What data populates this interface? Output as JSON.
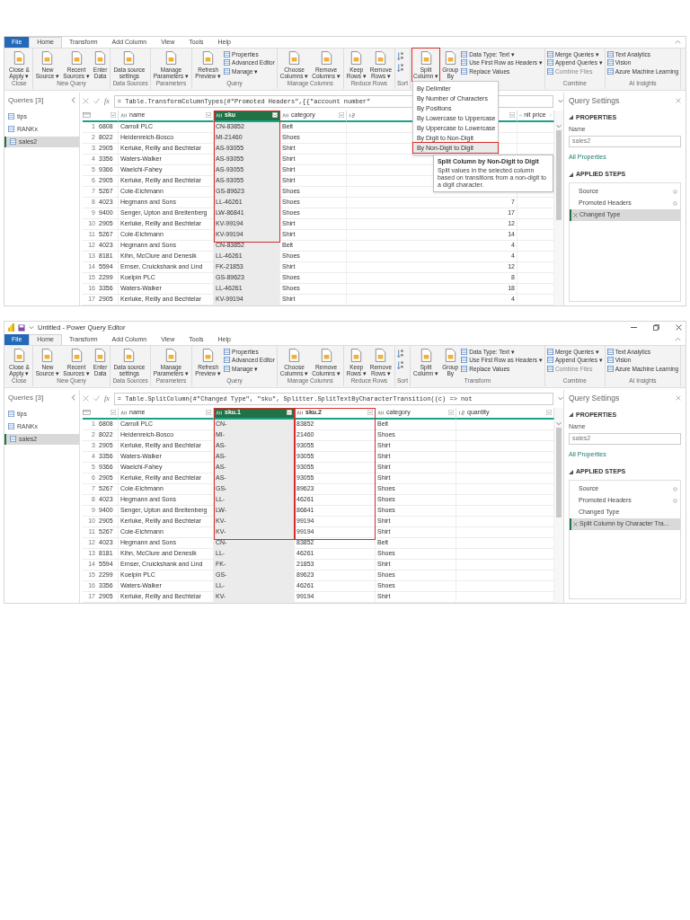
{
  "screens": [
    {
      "tabs": [
        {
          "label": "File",
          "kind": "file",
          "selected": false
        },
        {
          "label": "Home",
          "kind": "tab",
          "selected": true
        },
        {
          "label": "Transform",
          "kind": "tab",
          "selected": false
        },
        {
          "label": "Add Column",
          "kind": "tab",
          "selected": false
        },
        {
          "label": "View",
          "kind": "tab",
          "selected": false
        },
        {
          "label": "Tools",
          "kind": "tab",
          "selected": false
        },
        {
          "label": "Help",
          "kind": "tab",
          "selected": false
        }
      ],
      "ribbon": [
        {
          "label": "Close",
          "buttons": [
            {
              "label": "Close &\nApply ▾",
              "kind": "large",
              "highlighted": false,
              "disabled": false
            }
          ]
        },
        {
          "label": "New Query",
          "buttons": [
            {
              "label": "New\nSource ▾",
              "kind": "large",
              "highlighted": false,
              "disabled": false
            },
            {
              "label": "Recent\nSources ▾",
              "kind": "large",
              "highlighted": false,
              "disabled": false
            },
            {
              "label": "Enter\nData",
              "kind": "large",
              "highlighted": false,
              "disabled": false
            }
          ]
        },
        {
          "label": "Data Sources",
          "buttons": [
            {
              "label": "Data source\nsettings",
              "kind": "large",
              "highlighted": false,
              "disabled": false
            }
          ]
        },
        {
          "label": "Parameters",
          "buttons": [
            {
              "label": "Manage\nParameters ▾",
              "kind": "large",
              "highlighted": false,
              "disabled": false
            }
          ]
        },
        {
          "label": "Query",
          "buttons": [
            {
              "label": "Refresh\nPreview ▾",
              "kind": "large",
              "highlighted": false,
              "disabled": false
            },
            {
              "label": "Properties",
              "kind": "small",
              "highlighted": false,
              "disabled": false
            },
            {
              "label": "Advanced Editor",
              "kind": "small",
              "highlighted": false,
              "disabled": false
            },
            {
              "label": "Manage ▾",
              "kind": "small",
              "highlighted": false,
              "disabled": false
            }
          ]
        },
        {
          "label": "Manage Columns",
          "buttons": [
            {
              "label": "Choose\nColumns ▾",
              "kind": "large",
              "highlighted": false,
              "disabled": false
            },
            {
              "label": "Remove\nColumns ▾",
              "kind": "large",
              "highlighted": false,
              "disabled": false
            }
          ]
        },
        {
          "label": "Reduce Rows",
          "buttons": [
            {
              "label": "Keep\nRows ▾",
              "kind": "large",
              "highlighted": false,
              "disabled": false
            },
            {
              "label": "Remove\nRows ▾",
              "kind": "large",
              "highlighted": false,
              "disabled": false
            }
          ]
        },
        {
          "label": "Sort",
          "buttons": [
            {
              "kind": "icon",
              "highlighted": false,
              "disabled": false
            },
            {
              "kind": "icon",
              "highlighted": false,
              "disabled": false
            }
          ]
        },
        {
          "buttons": [
            {
              "label": "Split\nColumn ▾",
              "kind": "large",
              "highlighted": true,
              "disabled": false
            },
            {
              "label": "Group\nBy",
              "kind": "large",
              "highlighted": false,
              "disabled": false
            },
            {
              "label": "Data Type: Text ▾",
              "kind": "small",
              "highlighted": false,
              "disabled": false
            },
            {
              "label": "Use First Row as Headers ▾",
              "kind": "small",
              "highlighted": false,
              "disabled": false
            },
            {
              "label": "Replace Values",
              "kind": "small",
              "highlighted": false,
              "disabled": false
            }
          ]
        },
        {
          "label": "Combine",
          "buttons": [
            {
              "label": "Merge Queries ▾",
              "kind": "small",
              "highlighted": false,
              "disabled": false
            },
            {
              "label": "Append Queries ▾",
              "kind": "small",
              "highlighted": false,
              "disabled": false
            },
            {
              "label": "Combine Files",
              "kind": "small",
              "highlighted": false,
              "disabled": true
            }
          ]
        },
        {
          "label": "AI Insights",
          "buttons": [
            {
              "label": "Text Analytics",
              "kind": "small",
              "highlighted": false,
              "disabled": false
            },
            {
              "label": "Vision",
              "kind": "small",
              "highlighted": false,
              "disabled": false
            },
            {
              "label": "Azure Machine Learning",
              "kind": "small",
              "highlighted": false,
              "disabled": false
            }
          ]
        }
      ],
      "queries": {
        "title": "Queries [3]",
        "items": [
          {
            "label": "tips",
            "selected": false
          },
          {
            "label": "RANKx",
            "selected": false
          },
          {
            "label": "sales2",
            "selected": true
          }
        ]
      },
      "formula": {
        "fx": "fx",
        "text": "= Table.TransformColumnTypes(#\"Promoted Headers\",{{\"account number\""
      },
      "table": {
        "columns": [
          {
            "kind": "id",
            "selected": false,
            "highlighted": false
          },
          {
            "label": "name",
            "kind": "text",
            "selected": false,
            "highlighted": false
          },
          {
            "label": "sku",
            "kind": "text",
            "selected": true,
            "highlighted": true
          },
          {
            "label": "category",
            "kind": "text",
            "selected": false,
            "highlighted": false
          },
          {
            "kind": "number",
            "selected": false,
            "highlighted": false
          },
          {
            "label": "nit price",
            "kind": "text",
            "selected": false,
            "highlighted": false
          }
        ],
        "rows": [
          {
            "num": "1",
            "cells": [
              "6808",
              "Carroll PLC",
              "CN-83852",
              "Belt",
              null,
              null
            ]
          },
          {
            "num": "2",
            "cells": [
              "8022",
              "Heidenreich-Bosco",
              "MI-21460",
              "Shoes",
              null,
              null
            ]
          },
          {
            "num": "3",
            "cells": [
              "2905",
              "Kerluke, Reilly and Bechtelar",
              "AS-93055",
              "Shirt",
              null,
              null
            ]
          },
          {
            "num": "4",
            "cells": [
              "3356",
              "Waters-Walker",
              "AS-93055",
              "Shirt",
              null,
              null
            ]
          },
          {
            "num": "5",
            "cells": [
              "9366",
              "Waelchi-Fahey",
              "AS-93055",
              "Shirt",
              null,
              null
            ]
          },
          {
            "num": "6",
            "cells": [
              "2905",
              "Kerluke, Reilly and Bechtelar",
              "AS-93055",
              "Shirt",
              null,
              null
            ]
          },
          {
            "num": "7",
            "cells": [
              "5267",
              "Cole-Eichmann",
              "GS-89623",
              "Shoes",
              null,
              null
            ]
          },
          {
            "num": "8",
            "cells": [
              "4023",
              "Hegmann and Sons",
              "LL-46261",
              "Shoes",
              "7",
              null
            ]
          },
          {
            "num": "9",
            "cells": [
              "9400",
              "Senger, Upton and Breitenberg",
              "LW-86841",
              "Shoes",
              "17",
              null
            ]
          },
          {
            "num": "10",
            "cells": [
              "2905",
              "Kerluke, Reilly and Bechtelar",
              "KV-99194",
              "Shirt",
              "12",
              null
            ]
          },
          {
            "num": "11",
            "cells": [
              "5267",
              "Cole-Eichmann",
              "KV-99194",
              "Shirt",
              "14",
              null
            ]
          },
          {
            "num": "12",
            "cells": [
              "4023",
              "Hegmann and Sons",
              "CN-83852",
              "Belt",
              "4",
              null
            ]
          },
          {
            "num": "13",
            "cells": [
              "8181",
              "Kihn, McClure and Denesik",
              "LL-46261",
              "Shoes",
              "4",
              null
            ]
          },
          {
            "num": "14",
            "cells": [
              "5594",
              "Ernser, Cruickshank and Lind",
              "FK-21853",
              "Shirt",
              "12",
              null
            ]
          },
          {
            "num": "15",
            "cells": [
              "2299",
              "Koelpin PLC",
              "GS-89623",
              "Shoes",
              "8",
              null
            ]
          },
          {
            "num": "16",
            "cells": [
              "3356",
              "Waters-Walker",
              "LL-46261",
              "Shoes",
              "18",
              null
            ]
          },
          {
            "num": "17",
            "cells": [
              "2905",
              "Kerluke, Reilly and Bechtelar",
              "KV-99194",
              "Shirt",
              "4",
              null
            ]
          }
        ]
      },
      "settings": {
        "title": "Query Settings",
        "properties_label": "PROPERTIES",
        "name_label": "Name",
        "name_value": "sales2",
        "all_properties": "All Properties",
        "steps_label": "APPLIED STEPS",
        "steps": [
          {
            "label": "Source",
            "settings": true,
            "selected": false
          },
          {
            "label": "Promoted Headers",
            "settings": true,
            "selected": false
          },
          {
            "label": "Changed Type",
            "settings": false,
            "selected": true
          }
        ]
      },
      "split_menu": {
        "items": [
          {
            "label": "By Delimiter",
            "highlighted": false
          },
          {
            "label": "By Number of Characters",
            "highlighted": false
          },
          {
            "label": "By Positions",
            "highlighted": false
          },
          {
            "label": "By Lowercase to Uppercase",
            "highlighted": false
          },
          {
            "label": "By Uppercase to Lowercase",
            "highlighted": false
          },
          {
            "label": "By Digit to Non-Digit",
            "highlighted": false
          },
          {
            "label": "By Non-Digit to Digit",
            "highlighted": true
          }
        ],
        "tooltip": {
          "title": "Split Column by Non-Digit to Digit",
          "text": "Split values in the selected column based on transitions from a non-digit to a digit character."
        }
      }
    },
    {
      "title_bar": {
        "title": "Untitled - Power Query Editor"
      },
      "tabs": [
        {
          "label": "File",
          "kind": "file",
          "selected": false
        },
        {
          "label": "Home",
          "kind": "tab",
          "selected": true
        },
        {
          "label": "Transform",
          "kind": "tab",
          "selected": false
        },
        {
          "label": "Add Column",
          "kind": "tab",
          "selected": false
        },
        {
          "label": "View",
          "kind": "tab",
          "selected": false
        },
        {
          "label": "Tools",
          "kind": "tab",
          "selected": false
        },
        {
          "label": "Help",
          "kind": "tab",
          "selected": false
        }
      ],
      "ribbon": [
        {
          "label": "Close",
          "buttons": [
            {
              "label": "Close &\nApply ▾",
              "kind": "large",
              "highlighted": false,
              "disabled": false
            }
          ]
        },
        {
          "label": "New Query",
          "buttons": [
            {
              "label": "New\nSource ▾",
              "kind": "large",
              "highlighted": false,
              "disabled": false
            },
            {
              "label": "Recent\nSources ▾",
              "kind": "large",
              "highlighted": false,
              "disabled": false
            },
            {
              "label": "Enter\nData",
              "kind": "large",
              "highlighted": false,
              "disabled": false
            }
          ]
        },
        {
          "label": "Data Sources",
          "buttons": [
            {
              "label": "Data source\nsettings",
              "kind": "large",
              "highlighted": false,
              "disabled": false
            }
          ]
        },
        {
          "label": "Parameters",
          "buttons": [
            {
              "label": "Manage\nParameters ▾",
              "kind": "large",
              "highlighted": false,
              "disabled": false
            }
          ]
        },
        {
          "label": "Query",
          "buttons": [
            {
              "label": "Refresh\nPreview ▾",
              "kind": "large",
              "highlighted": false,
              "disabled": false
            },
            {
              "label": "Properties",
              "kind": "small",
              "highlighted": false,
              "disabled": false
            },
            {
              "label": "Advanced Editor",
              "kind": "small",
              "highlighted": false,
              "disabled": false
            },
            {
              "label": "Manage ▾",
              "kind": "small",
              "highlighted": false,
              "disabled": false
            }
          ]
        },
        {
          "label": "Manage Columns",
          "buttons": [
            {
              "label": "Choose\nColumns ▾",
              "kind": "large",
              "highlighted": false,
              "disabled": false
            },
            {
              "label": "Remove\nColumns ▾",
              "kind": "large",
              "highlighted": false,
              "disabled": false
            }
          ]
        },
        {
          "label": "Reduce Rows",
          "buttons": [
            {
              "label": "Keep\nRows ▾",
              "kind": "large",
              "highlighted": false,
              "disabled": false
            },
            {
              "label": "Remove\nRows ▾",
              "kind": "large",
              "highlighted": false,
              "disabled": false
            }
          ]
        },
        {
          "label": "Sort",
          "buttons": [
            {
              "kind": "icon",
              "highlighted": false,
              "disabled": false
            },
            {
              "kind": "icon",
              "highlighted": false,
              "disabled": false
            }
          ]
        },
        {
          "label": "Transform",
          "buttons": [
            {
              "label": "Split\nColumn ▾",
              "kind": "large",
              "highlighted": false,
              "disabled": false
            },
            {
              "label": "Group\nBy",
              "kind": "large",
              "highlighted": false,
              "disabled": false
            },
            {
              "label": "Data Type: Text ▾",
              "kind": "small",
              "highlighted": false,
              "disabled": false
            },
            {
              "label": "Use First Row as Headers ▾",
              "kind": "small",
              "highlighted": false,
              "disabled": false
            },
            {
              "label": "Replace Values",
              "kind": "small",
              "highlighted": false,
              "disabled": false
            }
          ]
        },
        {
          "label": "Combine",
          "buttons": [
            {
              "label": "Merge Queries ▾",
              "kind": "small",
              "highlighted": false,
              "disabled": false
            },
            {
              "label": "Append Queries ▾",
              "kind": "small",
              "highlighted": false,
              "disabled": false
            },
            {
              "label": "Combine Files",
              "kind": "small",
              "highlighted": false,
              "disabled": true
            }
          ]
        },
        {
          "label": "AI Insights",
          "buttons": [
            {
              "label": "Text Analytics",
              "kind": "small",
              "highlighted": false,
              "disabled": false
            },
            {
              "label": "Vision",
              "kind": "small",
              "highlighted": false,
              "disabled": false
            },
            {
              "label": "Azure Machine Learning",
              "kind": "small",
              "highlighted": false,
              "disabled": false
            }
          ]
        }
      ],
      "queries": {
        "title": "Queries [3]",
        "items": [
          {
            "label": "tips",
            "selected": false
          },
          {
            "label": "RANKx",
            "selected": false
          },
          {
            "label": "sales2",
            "selected": true
          }
        ]
      },
      "formula": {
        "fx": "fx",
        "text": "= Table.SplitColumn(#\"Changed Type\", \"sku\", Splitter.SplitTextByCharacterTransition((c) => not"
      },
      "table": {
        "columns": [
          {
            "kind": "id",
            "selected": false,
            "highlighted": false
          },
          {
            "label": "name",
            "kind": "text",
            "selected": false,
            "highlighted": false
          },
          {
            "label": "sku.1",
            "kind": "text",
            "selected": true,
            "highlighted": true
          },
          {
            "label": "sku.2",
            "kind": "text",
            "selected": false,
            "highlighted": true
          },
          {
            "label": "category",
            "kind": "text",
            "selected": false,
            "highlighted": false
          },
          {
            "label": "quantity",
            "kind": "number",
            "selected": false,
            "highlighted": false
          }
        ],
        "rows": [
          {
            "num": "1",
            "cells": [
              "6808",
              "Carroll PLC",
              "CN-",
              "83852",
              "Belt"
            ]
          },
          {
            "num": "2",
            "cells": [
              "8022",
              "Heidenreich-Bosco",
              "MI-",
              "21460",
              "Shoes"
            ]
          },
          {
            "num": "3",
            "cells": [
              "2905",
              "Kerluke, Reilly and Bechtelar",
              "AS-",
              "93055",
              "Shirt"
            ]
          },
          {
            "num": "4",
            "cells": [
              "3356",
              "Waters-Walker",
              "AS-",
              "93055",
              "Shirt"
            ]
          },
          {
            "num": "5",
            "cells": [
              "9366",
              "Waelchi-Fahey",
              "AS-",
              "93055",
              "Shirt"
            ]
          },
          {
            "num": "6",
            "cells": [
              "2905",
              "Kerluke, Reilly and Bechtelar",
              "AS-",
              "93055",
              "Shirt"
            ]
          },
          {
            "num": "7",
            "cells": [
              "5267",
              "Cole-Eichmann",
              "GS-",
              "89623",
              "Shoes"
            ]
          },
          {
            "num": "8",
            "cells": [
              "4023",
              "Hegmann and Sons",
              "LL-",
              "46261",
              "Shoes"
            ]
          },
          {
            "num": "9",
            "cells": [
              "9400",
              "Senger, Upton and Breitenberg",
              "LW-",
              "86841",
              "Shoes"
            ]
          },
          {
            "num": "10",
            "cells": [
              "2905",
              "Kerluke, Reilly and Bechtelar",
              "KV-",
              "99194",
              "Shirt"
            ]
          },
          {
            "num": "11",
            "cells": [
              "5267",
              "Cole-Eichmann",
              "KV-",
              "99194",
              "Shirt"
            ]
          },
          {
            "num": "12",
            "cells": [
              "4023",
              "Hegmann and Sons",
              "CN-",
              "83852",
              "Belt"
            ]
          },
          {
            "num": "13",
            "cells": [
              "8181",
              "Kihn, McClure and Denesik",
              "LL-",
              "46261",
              "Shoes"
            ]
          },
          {
            "num": "14",
            "cells": [
              "5594",
              "Ernser, Cruickshank and Lind",
              "FK-",
              "21853",
              "Shirt"
            ]
          },
          {
            "num": "15",
            "cells": [
              "2299",
              "Koelpin PLC",
              "GS-",
              "89623",
              "Shoes"
            ]
          },
          {
            "num": "16",
            "cells": [
              "3356",
              "Waters-Walker",
              "LL-",
              "46261",
              "Shoes"
            ]
          },
          {
            "num": "17",
            "cells": [
              "2905",
              "Kerluke, Reilly and Bechtelar",
              "KV-",
              "99194",
              "Shirt"
            ]
          }
        ]
      },
      "settings": {
        "title": "Query Settings",
        "properties_label": "PROPERTIES",
        "name_label": "Name",
        "name_value": "sales2",
        "all_properties": "All Properties",
        "steps_label": "APPLIED STEPS",
        "steps": [
          {
            "label": "Source",
            "settings": true,
            "selected": false
          },
          {
            "label": "Promoted Headers",
            "settings": true,
            "selected": false
          },
          {
            "label": "Changed Type",
            "settings": false,
            "selected": false
          },
          {
            "label": "Split Column by Character Tra...",
            "settings": false,
            "selected": true
          }
        ]
      }
    }
  ]
}
